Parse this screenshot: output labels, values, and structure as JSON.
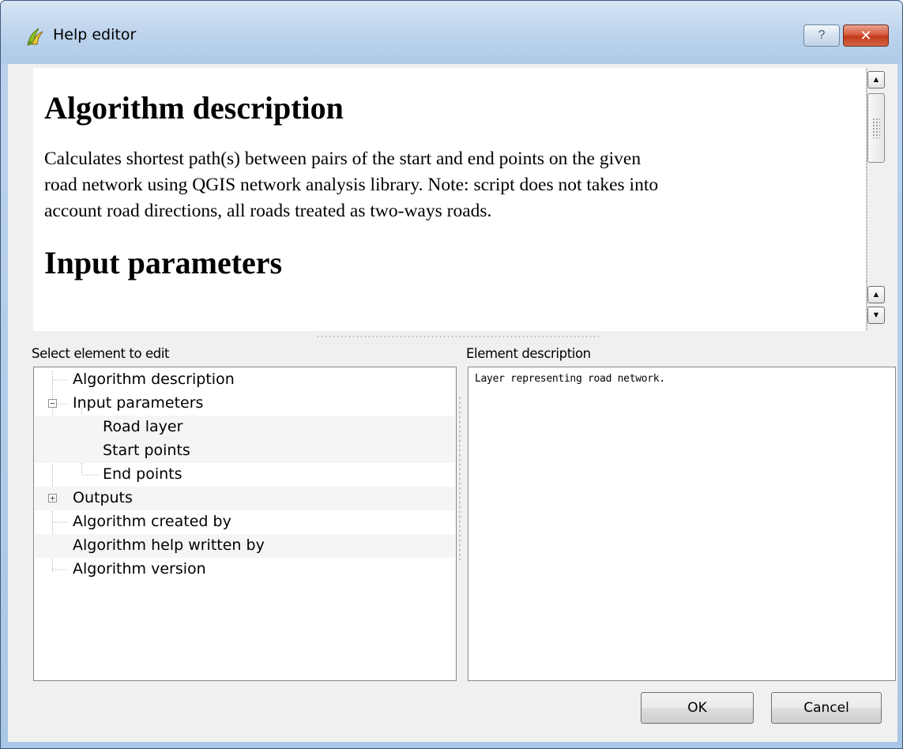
{
  "window": {
    "title": "Help editor",
    "help_button": "?",
    "close_button": "✕"
  },
  "preview": {
    "heading1": "Algorithm description",
    "paragraph_lines": [
      "Calculates shortest path(s) between pairs of the start and end points on the given",
      "road network using QGIS network analysis library. Note: script does not takes into",
      "account road directions, all roads treated as two-ways roads."
    ],
    "heading2": "Input parameters"
  },
  "tree_panel": {
    "label": "Select element to edit",
    "items": [
      {
        "label": "Algorithm description",
        "level": 0
      },
      {
        "label": "Input parameters",
        "level": 0,
        "expander": "−"
      },
      {
        "label": "Road layer",
        "level": 1
      },
      {
        "label": "Start points",
        "level": 1
      },
      {
        "label": "End points",
        "level": 1
      },
      {
        "label": "Outputs",
        "level": 0,
        "expander": "+"
      },
      {
        "label": "Algorithm created by",
        "level": 0
      },
      {
        "label": "Algorithm help written by",
        "level": 0
      },
      {
        "label": "Algorithm version",
        "level": 0
      }
    ]
  },
  "description_panel": {
    "label": "Element description",
    "text": "Layer representing road network."
  },
  "buttons": {
    "ok": "OK",
    "cancel": "Cancel"
  },
  "colors": {
    "titlebar": "#bcd3ec",
    "client_bg": "#f0f0f0",
    "close_button": "#c2391a"
  }
}
